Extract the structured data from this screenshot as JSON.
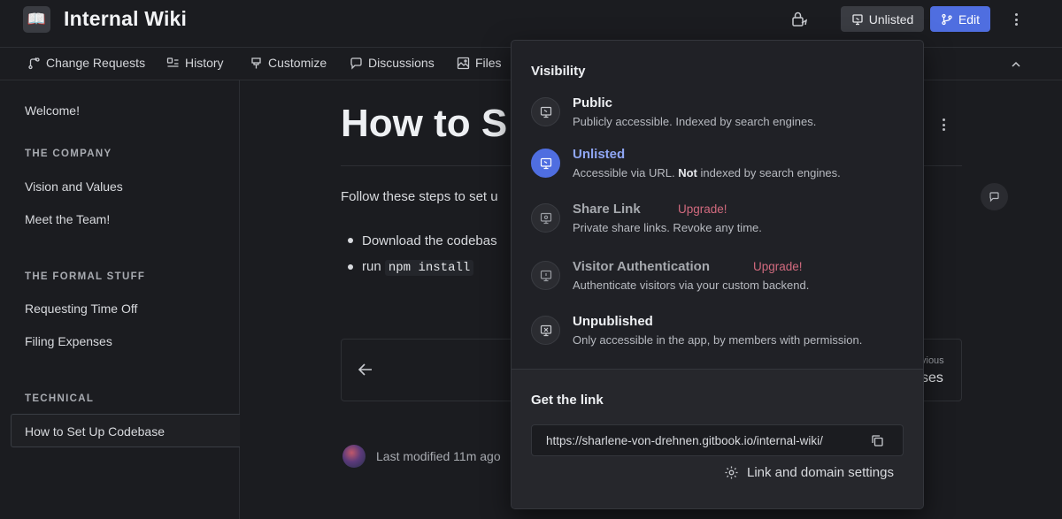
{
  "header": {
    "logo_glyph": "📖",
    "title": "Internal Wiki",
    "unlisted_label": "Unlisted",
    "edit_label": "Edit",
    "accent_color": "#4f6ee0"
  },
  "subnav": {
    "items": [
      {
        "label": "Change Requests",
        "icon": "change-request-icon"
      },
      {
        "label": "History",
        "icon": "history-icon"
      },
      {
        "label": "Customize",
        "icon": "brush-icon"
      },
      {
        "label": "Discussions",
        "icon": "chat-icon"
      },
      {
        "label": "Files",
        "icon": "image-icon"
      }
    ]
  },
  "sidebar": {
    "welcome": "Welcome!",
    "sections": [
      {
        "title": "THE COMPANY",
        "items": [
          "Vision and Values",
          "Meet the Team!"
        ]
      },
      {
        "title": "THE FORMAL STUFF",
        "items": [
          "Requesting Time Off",
          "Filing Expenses"
        ]
      },
      {
        "title": "TECHNICAL",
        "items": [
          "How to Set Up Codebase"
        ]
      }
    ]
  },
  "main": {
    "title": "How to S",
    "intro": "Follow these steps to set u",
    "bullets": [
      {
        "text": "Download the codebas"
      },
      {
        "prefix": "run ",
        "code": "npm install"
      }
    ],
    "previous_label": "vious",
    "previous_title": "ses",
    "modified": "Last modified 11m ago"
  },
  "popover": {
    "heading": "Visibility",
    "options": [
      {
        "title": "Public",
        "desc": "Publicly accessible. Indexed by search engines.",
        "state": "normal"
      },
      {
        "title": "Unlisted",
        "desc_pre": "Accessible via URL. ",
        "desc_bold": "Not",
        "desc_post": " indexed by search engines.",
        "state": "selected"
      },
      {
        "title": "Share Link",
        "badge": "Upgrade!",
        "desc": "Private share links. Revoke any time.",
        "state": "disabled"
      },
      {
        "title": "Visitor Authentication",
        "badge": "Upgrade!",
        "desc": "Authenticate visitors via your custom backend.",
        "state": "disabled"
      },
      {
        "title": "Unpublished",
        "desc": "Only accessible in the app, by members with permission.",
        "state": "normal"
      }
    ],
    "link_heading": "Get the link",
    "link_url": "https://sharlene-von-drehnen.gitbook.io/internal-wiki/",
    "link_settings_label": "Link and domain settings"
  }
}
